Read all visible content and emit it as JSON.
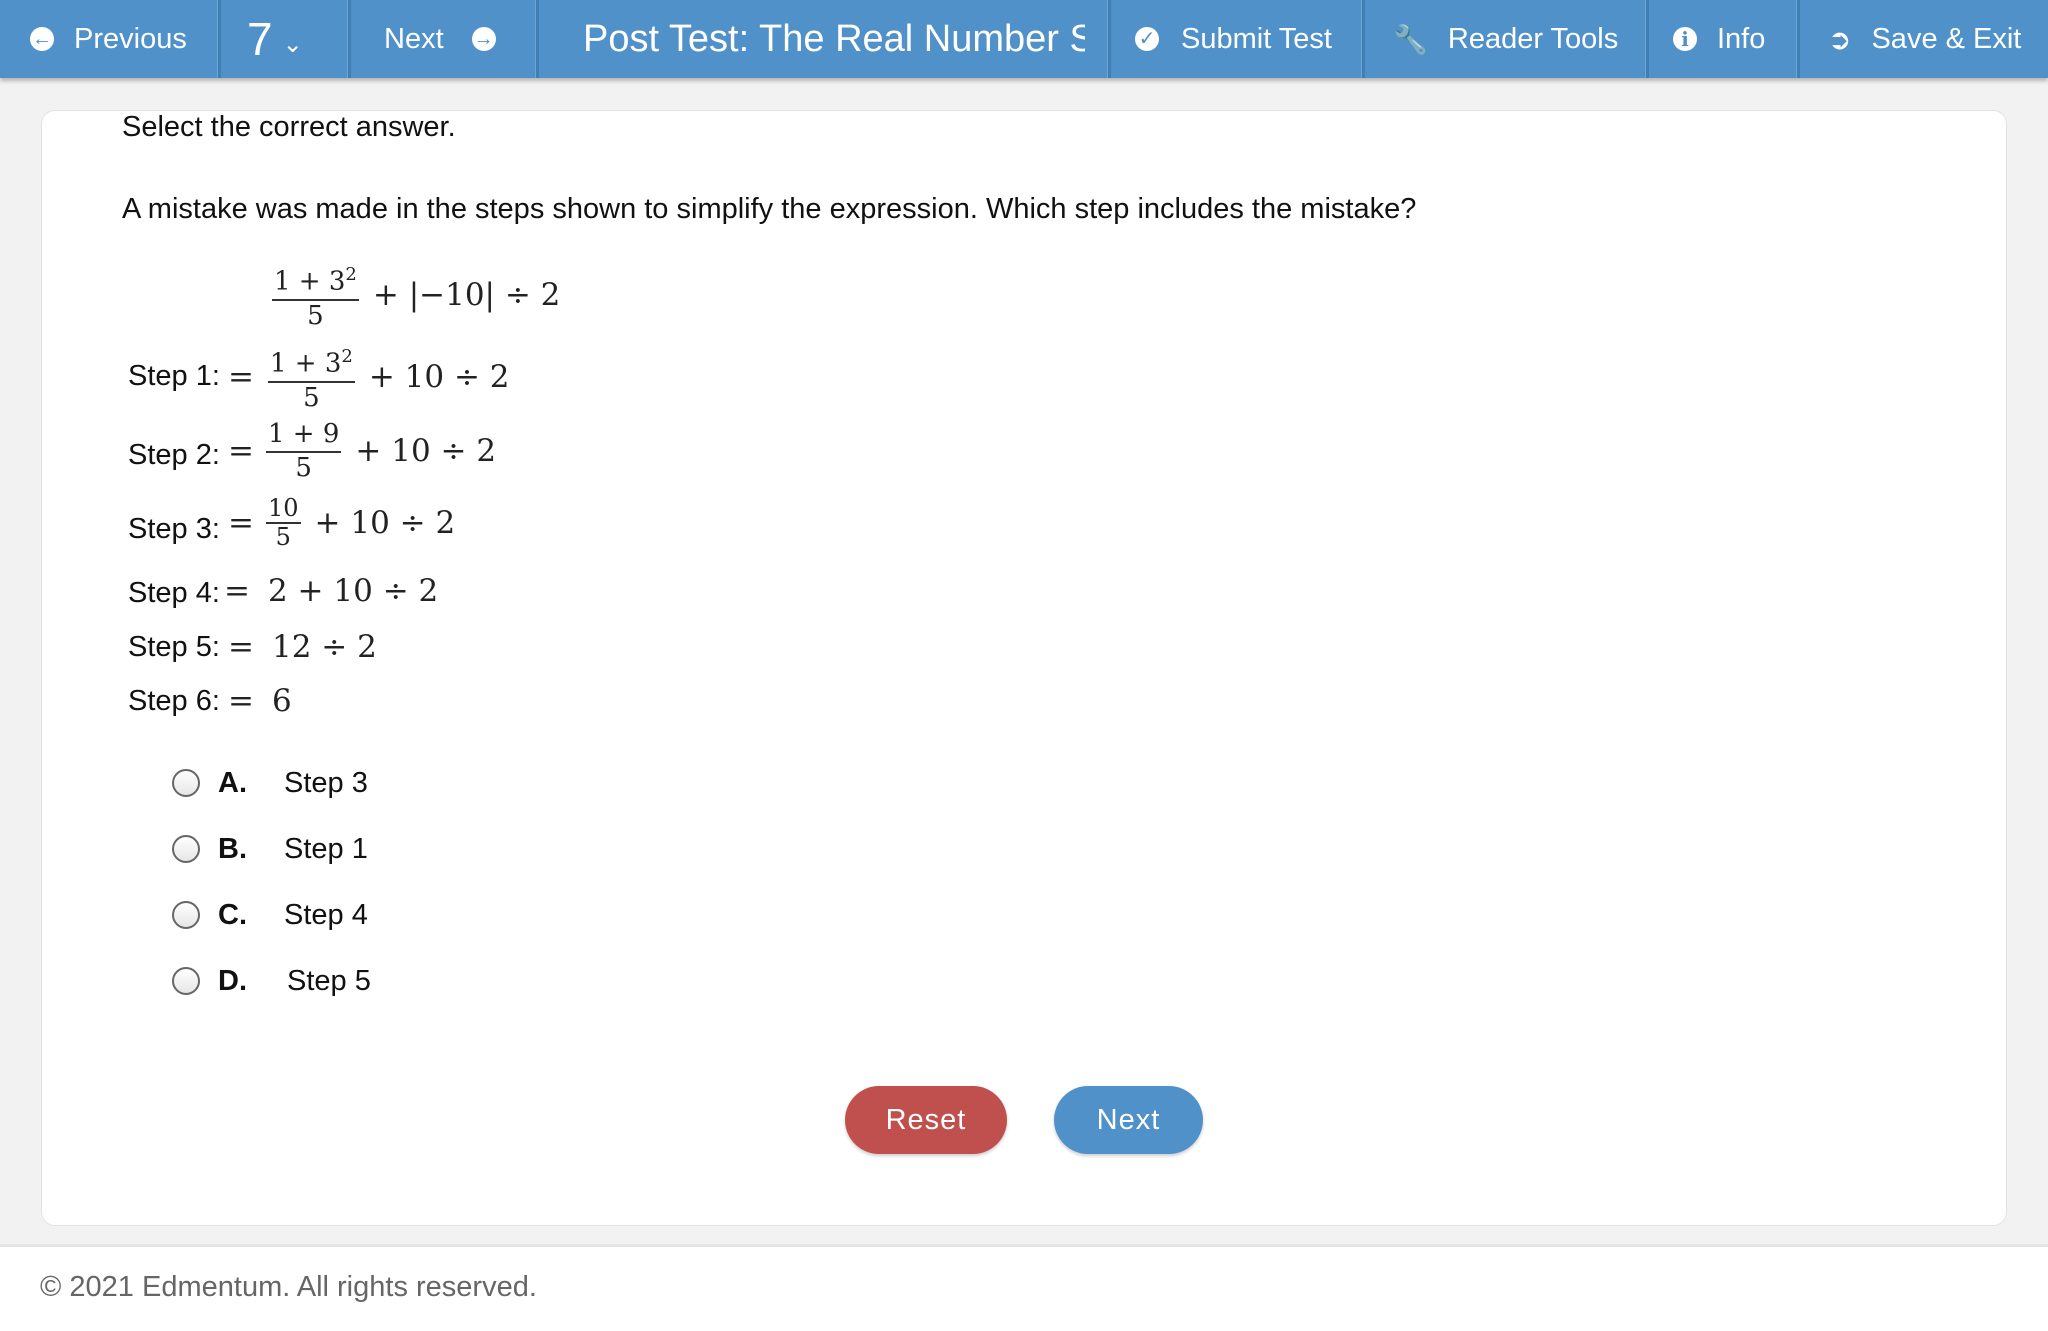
{
  "nav": {
    "previous": "Previous",
    "question_number": "7",
    "next": "Next",
    "title": "Post Test: The Real Number System",
    "submit": "Submit Test",
    "reader_tools": "Reader Tools",
    "info": "Info",
    "save_exit": "Save & Exit"
  },
  "question": {
    "instruction": "Select the correct answer.",
    "prompt": "A mistake was made in the steps shown to simplify the expression. Which step includes the mistake?",
    "expression": {
      "numerator": "1 + 3",
      "exponent": "2",
      "denominator": "5",
      "rest": "+ |−10| ÷ 2"
    },
    "steps": [
      {
        "label": "Step 1:",
        "eq": "=",
        "numerator": "1 + 3",
        "exponent": "2",
        "denominator": "5",
        "rest": "+ 10 ÷ 2"
      },
      {
        "label": "Step 2:",
        "eq": "=",
        "numerator": "1 + 9",
        "denominator": "5",
        "rest": "+ 10 ÷ 2"
      },
      {
        "label": "Step 3:",
        "eq": "=",
        "numerator": "10",
        "denominator": "5",
        "rest": "+ 10 ÷ 2"
      },
      {
        "label": "Step 4:",
        "eq": "=",
        "rest": "2 + 10 ÷ 2"
      },
      {
        "label": "Step 5:",
        "eq": "=",
        "rest": "12 ÷ 2"
      },
      {
        "label": "Step 6:",
        "eq": "=",
        "rest": "6"
      }
    ]
  },
  "options": [
    {
      "letter": "A.",
      "text": "Step 3"
    },
    {
      "letter": "B.",
      "text": "Step 1"
    },
    {
      "letter": "C.",
      "text": "Step 4"
    },
    {
      "letter": "D.",
      "text": "Step 5"
    }
  ],
  "buttons": {
    "reset": "Reset",
    "next": "Next"
  },
  "footer": {
    "copyright": "© 2021 Edmentum. All rights reserved."
  },
  "colors": {
    "nav_bg": "#4f91c8",
    "reset_btn": "#c0504d",
    "next_btn": "#4f91c8"
  }
}
